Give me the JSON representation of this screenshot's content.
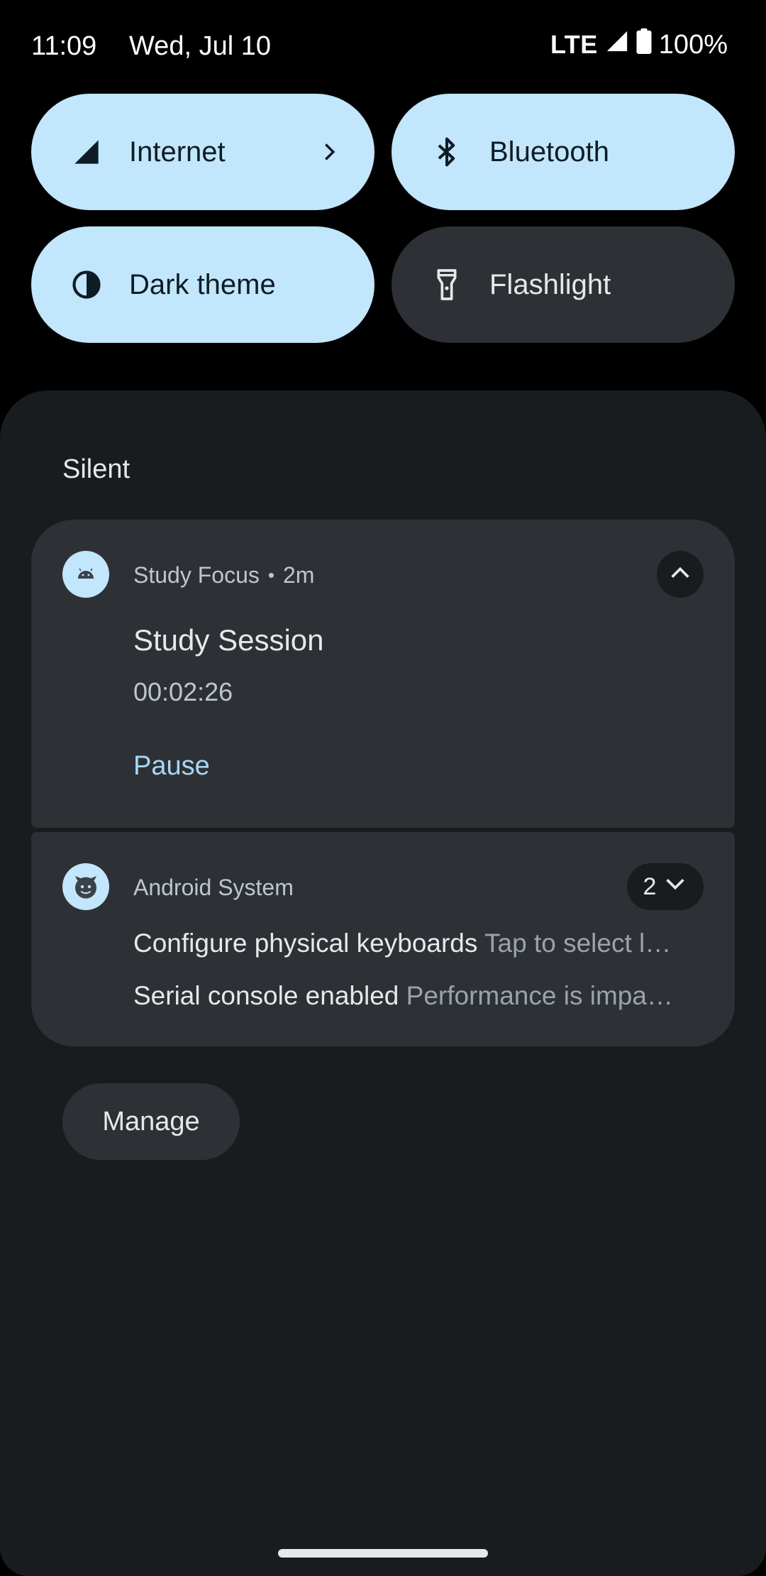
{
  "status_bar": {
    "time": "11:09",
    "date": "Wed, Jul 10",
    "network": "LTE",
    "battery": "100%"
  },
  "quick_settings": {
    "tiles": [
      {
        "label": "Internet",
        "icon": "signal-icon",
        "state": "on",
        "has_chevron": true
      },
      {
        "label": "Bluetooth",
        "icon": "bluetooth-icon",
        "state": "on"
      },
      {
        "label": "Dark theme",
        "icon": "contrast-icon",
        "state": "on"
      },
      {
        "label": "Flashlight",
        "icon": "flashlight-icon",
        "state": "off"
      }
    ]
  },
  "shade": {
    "section_label": "Silent",
    "notifications": [
      {
        "app_name": "Study Focus",
        "separator": "•",
        "time_ago": "2m",
        "title": "Study Session",
        "text": "00:02:26",
        "action": "Pause",
        "icon": "android-icon"
      },
      {
        "app_name": "Android System",
        "count": "2",
        "icon": "android-system-icon",
        "rows": [
          {
            "title": "Configure physical keyboards",
            "text": "Tap to select l…"
          },
          {
            "title": "Serial console enabled",
            "text": "Performance is impa…"
          }
        ]
      }
    ],
    "manage_label": "Manage"
  },
  "colors": {
    "tile_on": "#c2e6fc",
    "tile_off": "#2d3135",
    "shade_bg": "#191c1f",
    "card_bg": "#2d3135",
    "accent": "#a8d6f5"
  }
}
